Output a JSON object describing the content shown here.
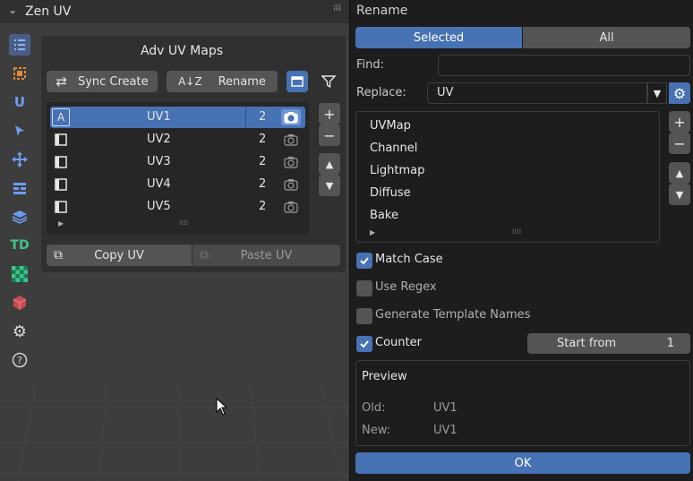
{
  "panel": {
    "title": "Zen UV",
    "adv_title": "Adv UV Maps",
    "sync_create": "Sync Create",
    "rename": "Rename",
    "copy_uv": "Copy UV",
    "paste_uv": "Paste UV",
    "uv_rows": [
      {
        "name": "UV1",
        "count": "2",
        "active": true
      },
      {
        "name": "UV2",
        "count": "2",
        "active": false
      },
      {
        "name": "UV3",
        "count": "2",
        "active": false
      },
      {
        "name": "UV4",
        "count": "2",
        "active": false
      },
      {
        "name": "UV5",
        "count": "2",
        "active": false
      }
    ],
    "side_tabs": [
      "list-icon",
      "uv-islands-icon",
      "u-icon",
      "select-cursor-icon",
      "move-icon",
      "stack-icon",
      "layers-icon",
      "td-icon",
      "checker-icon",
      "box-icon",
      "gear-icon",
      "help-icon"
    ],
    "td_label": "TD",
    "u_label": "U"
  },
  "popup": {
    "title": "Rename",
    "tab_selected": "Selected",
    "tab_all": "All",
    "find_label": "Find:",
    "find_value": "",
    "replace_label": "Replace:",
    "replace_value": "UV",
    "presets": [
      "UVMap",
      "Channel",
      "Lightmap",
      "Diffuse",
      "Bake"
    ],
    "match_case": "Match Case",
    "use_regex": "Use Regex",
    "gen_template": "Generate Template Names",
    "counter": "Counter",
    "start_from_label": "Start from",
    "start_from_value": "1",
    "preview_title": "Preview",
    "old_label": "Old:",
    "old_value": "UV1",
    "new_label": "New:",
    "new_value": "UV1",
    "ok": "OK",
    "checks": {
      "match_case": true,
      "use_regex": false,
      "gen_template": false,
      "counter": true
    }
  },
  "colors": {
    "accent": "#4772b3",
    "td": "#43c28a"
  }
}
